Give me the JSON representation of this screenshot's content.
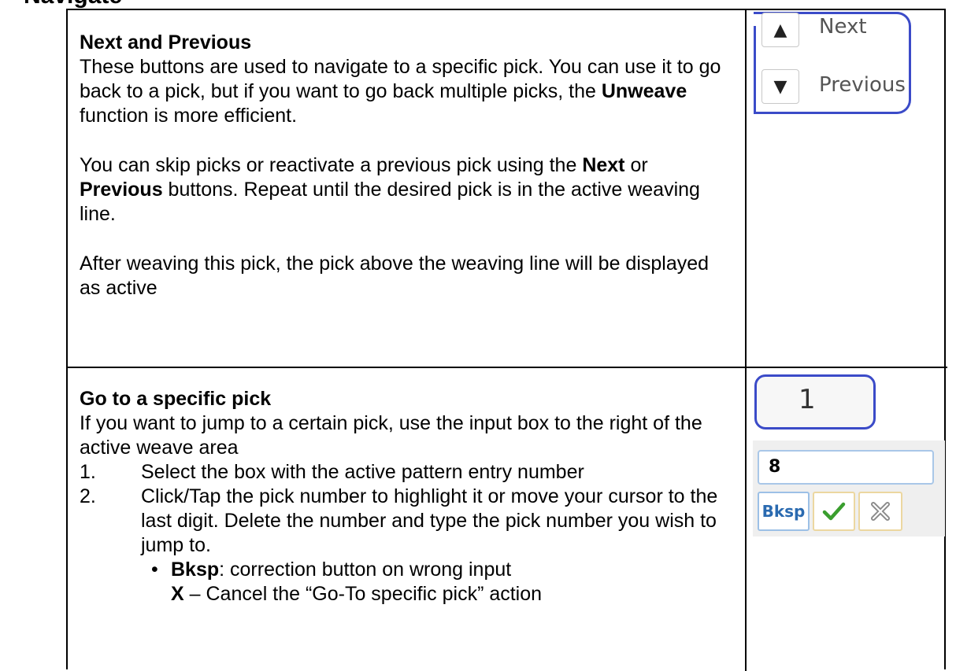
{
  "doc": {
    "section_heading": "Navigate",
    "row1": {
      "title": "Next and Previous",
      "p1_a": "These buttons are used to navigate to a specific pick.  You can use it to go back to a pick, but if you want to go back multiple picks, the ",
      "p1_bold": "Unweave",
      "p1_b": " function is more efficient.",
      "p2_a": "You can skip picks or reactivate a previous pick using the ",
      "p2_bold1": "Next",
      "p2_mid": " or ",
      "p2_bold2": "Previous",
      "p2_b": " buttons. Repeat until the desired pick is in the active weaving line.",
      "p3": "After weaving this pick, the pick above the weaving line will be displayed as active"
    },
    "row2": {
      "title": "Go to a specific pick",
      "intro": "If you want to jump to a certain pick, use the input box to the right of the active weave area",
      "step1_num": "1.",
      "step1_text": "Select the box with the active pattern entry number",
      "step2_num": "2.",
      "step2_text": "Click/Tap the pick number to highlight it or move your cursor to the last digit. Delete the number and type the pick number you wish to jump to.",
      "bullet1_bold": "Bksp",
      "bullet1_text": ":  correction button on wrong input",
      "bullet2_bold": "X",
      "bullet2_text": "  – Cancel the “Go-To specific pick” action"
    }
  },
  "widgets": {
    "nav": {
      "up_icon": "triangle-up-icon",
      "up_glyph": "▲",
      "down_icon": "triangle-down-icon",
      "down_glyph": "▼",
      "next_label": "Next",
      "previous_label": "Previous",
      "border_color": "#3b4bc8"
    },
    "goto": {
      "current_pick": "1",
      "input_value": "8",
      "bksp_label": "Bksp",
      "ok_icon": "checkmark-icon",
      "cancel_icon": "close-icon",
      "check_color": "#3a9e2e",
      "cancel_color": "#8a8a8a"
    }
  }
}
